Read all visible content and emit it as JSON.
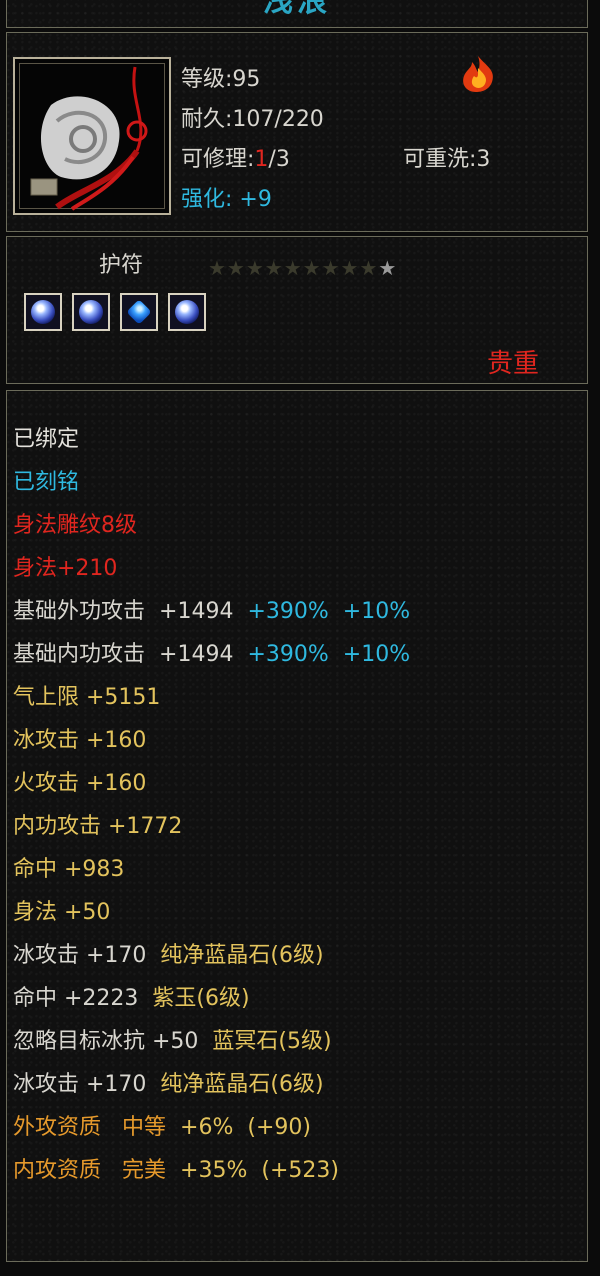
{
  "item": {
    "name": "浅浪",
    "level": "等级:95",
    "durability": "耐久:107/220",
    "repairable_label": "可修理:",
    "repairable_used": "1",
    "repairable_total": "/3",
    "rewashable": "可重洗:3",
    "enhance": "强化: +9",
    "type": "护符",
    "stars": "★★★★★★★★★",
    "star_last": "★",
    "rarity": "贵重",
    "icon": "jade-pendant-icon",
    "status_icon": "fire-icon"
  },
  "gems": [
    {
      "icon": "round-gem-icon"
    },
    {
      "icon": "round-gem-icon"
    },
    {
      "icon": "sapphire-gem-icon"
    },
    {
      "icon": "round-gem-icon"
    }
  ],
  "bind": "已绑定",
  "engraved": "已刻铭",
  "carving": "身法雕纹8级",
  "carving_bonus": "身法+210",
  "base_attack": [
    {
      "label": "基础外功攻击",
      "value": "+1494",
      "pct1": "+390%",
      "pct2": "+10%"
    },
    {
      "label": "基础内功攻击",
      "value": "+1494",
      "pct1": "+390%",
      "pct2": "+10%"
    }
  ],
  "attributes": [
    "气上限  +5151",
    "冰攻击  +160",
    "火攻击  +160",
    "内功攻击  +1772",
    "命中  +983",
    "身法  +50"
  ],
  "gem_stats": [
    {
      "stat": "冰攻击  +170",
      "gem": "纯净蓝晶石(6级)"
    },
    {
      "stat": "命中  +2223",
      "gem": "紫玉(6级)"
    },
    {
      "stat": "忽略目标冰抗  +50",
      "gem": "蓝冥石(5级)"
    },
    {
      "stat": "冰攻击  +170",
      "gem": "纯净蓝晶石(6级)"
    }
  ],
  "aptitudes": [
    {
      "label": "外攻资质",
      "grade": "中等",
      "pct": "+6%",
      "bonus": "(+90)"
    },
    {
      "label": "内攻资质",
      "grade": "完美",
      "pct": "+35%",
      "bonus": "(+523)"
    }
  ]
}
